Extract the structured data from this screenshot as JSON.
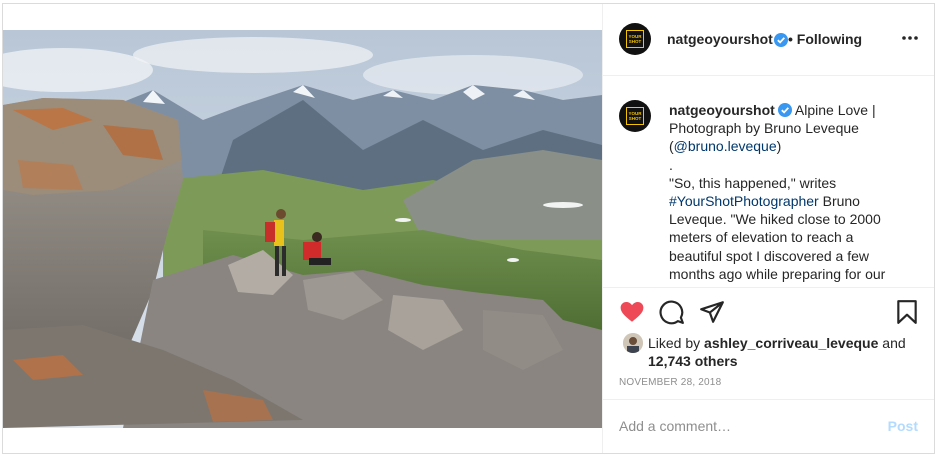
{
  "post": {
    "username": "natgeoyourshot",
    "follow_status": "• Following",
    "avatar_text": [
      "YOUR",
      "SHOT"
    ],
    "caption": {
      "title": " Alpine Love | Photograph by Bruno Leveque (",
      "mention": "@bruno.leveque",
      "mention_close": ")",
      "dot": ".",
      "line1": "\"So, this happened,\" writes ",
      "hashtag": "#YourShotPhotographer",
      "line2": " Bruno Leveque. \"We hiked close to 2000 meters of elevation to reach a beautiful spot I discovered a few months ago while preparing for our"
    },
    "likes": {
      "prefix": "Liked by ",
      "user": "ashley_corriveau_leveque",
      "and": " and",
      "others": "12,743 others"
    },
    "date": "NOVEMBER 28, 2018",
    "comment_placeholder": "Add a comment…",
    "post_label": "Post"
  },
  "icons": {
    "like": "heart-filled-icon",
    "comment": "comment-icon",
    "share": "share-icon",
    "save": "bookmark-icon",
    "more": "more-options-icon",
    "verified": "verified-badge-icon"
  },
  "colors": {
    "like_red": "#ed4956",
    "verified_blue": "#3897f0",
    "link": "#00376b",
    "muted": "#8e8e8e",
    "post_disabled": "#b3dbff",
    "brand_yellow": "#f5c400"
  }
}
